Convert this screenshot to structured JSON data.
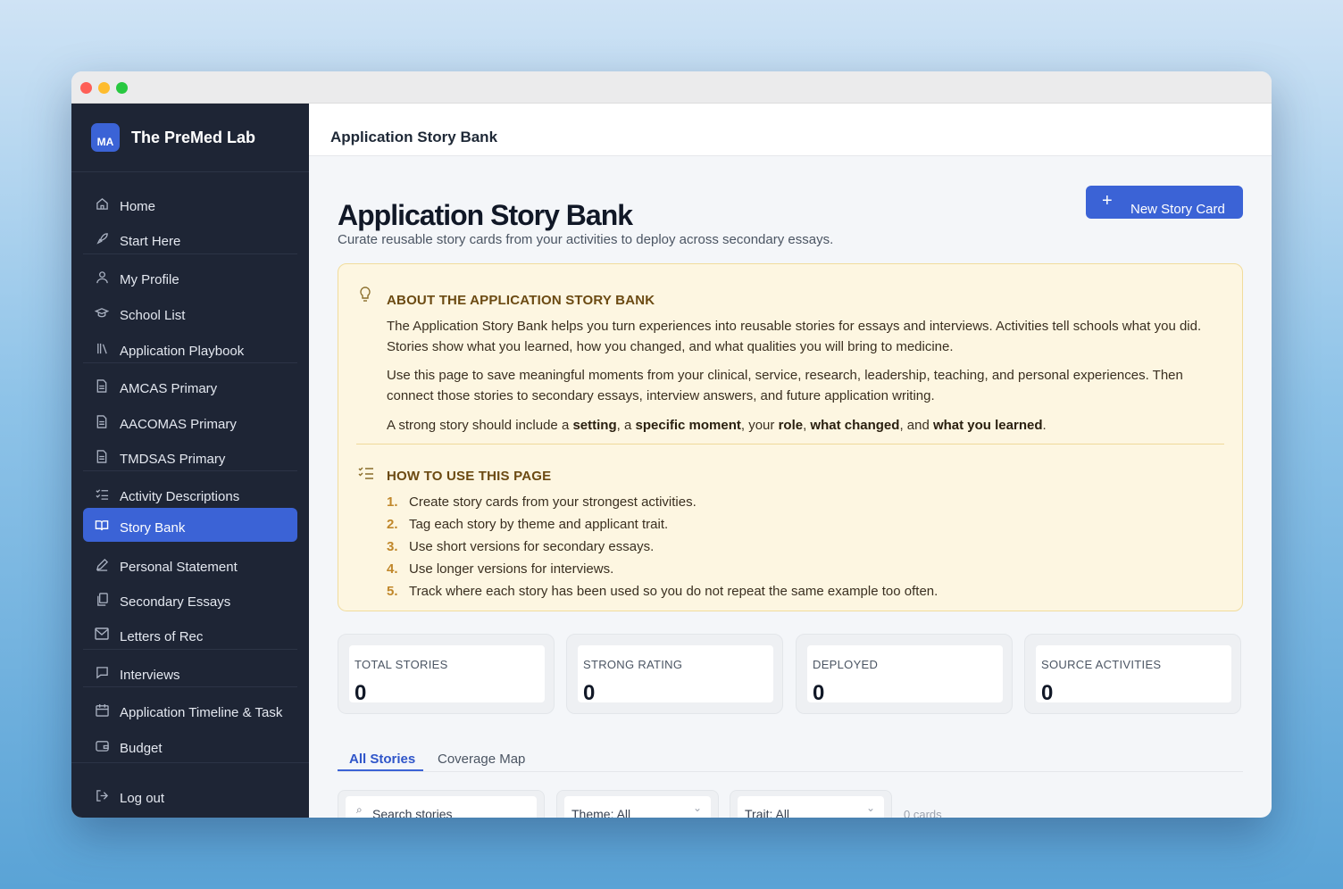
{
  "brand": {
    "logo_text": "MA",
    "name": "The PreMed Lab"
  },
  "sidebar": {
    "items": [
      {
        "label": "Home",
        "icon": "home-icon"
      },
      {
        "label": "Start Here",
        "icon": "rocket-icon"
      },
      {
        "label": "My Profile",
        "icon": "user-icon"
      },
      {
        "label": "School List",
        "icon": "graduation-cap-icon"
      },
      {
        "label": "Application Playbook",
        "icon": "library-icon"
      },
      {
        "label": "AMCAS Primary",
        "icon": "document-icon"
      },
      {
        "label": "AACOMAS Primary",
        "icon": "document-icon"
      },
      {
        "label": "TMDSAS Primary",
        "icon": "document-icon"
      },
      {
        "label": "Activity Descriptions",
        "icon": "list-check-icon"
      },
      {
        "label": "Story Bank",
        "icon": "book-open-icon",
        "active": true
      },
      {
        "label": "Personal Statement",
        "icon": "pencil-icon"
      },
      {
        "label": "Secondary Essays",
        "icon": "copy-icon"
      },
      {
        "label": "Letters of Rec",
        "icon": "mail-icon"
      },
      {
        "label": "Interviews",
        "icon": "message-icon"
      },
      {
        "label": "Application Timeline & Task",
        "icon": "calendar-icon"
      },
      {
        "label": "Budget",
        "icon": "wallet-icon"
      }
    ],
    "logout_label": "Log out"
  },
  "topbar": {
    "title": "Application Story Bank"
  },
  "page": {
    "title": "Application Story Bank",
    "subtitle": "Curate reusable story cards from your activities to deploy across secondary essays.",
    "new_button_label": "New Story Card"
  },
  "about": {
    "heading": "ABOUT THE APPLICATION STORY BANK",
    "p1": "The Application Story Bank helps you turn experiences into reusable stories for essays and interviews. Activities tell schools what you did. Stories show what you learned, how you changed, and what qualities you will bring to medicine.",
    "p2": "Use this page to save meaningful moments from your clinical, service, research, leadership, teaching, and personal experiences. Then connect those stories to secondary essays, interview answers, and future application writing.",
    "p3_parts": {
      "a": "A strong story should include a ",
      "b": "setting",
      "c": ", a ",
      "d": "specific moment",
      "e": ", your ",
      "f": "role",
      "g": ", ",
      "h": "what changed",
      "i": ", and ",
      "j": "what you learned",
      "k": "."
    },
    "howto_heading": "HOW TO USE THIS PAGE",
    "steps": [
      {
        "num": "1.",
        "text": "Create story cards from your strongest activities."
      },
      {
        "num": "2.",
        "text": "Tag each story by theme and applicant trait."
      },
      {
        "num": "3.",
        "text": "Use short versions for secondary essays."
      },
      {
        "num": "4.",
        "text": "Use longer versions for interviews."
      },
      {
        "num": "5.",
        "text": "Track where each story has been used so you do not repeat the same example too often."
      }
    ]
  },
  "stats": [
    {
      "label": "TOTAL STORIES",
      "value": "0"
    },
    {
      "label": "STRONG RATING",
      "value": "0"
    },
    {
      "label": "DEPLOYED",
      "value": "0"
    },
    {
      "label": "SOURCE ACTIVITIES",
      "value": "0"
    }
  ],
  "tabs": {
    "all": "All Stories",
    "coverage": "Coverage Map"
  },
  "filters": {
    "search_placeholder": "Search stories",
    "theme": "Theme: All",
    "trait": "Trait: All",
    "count": "0 cards"
  },
  "colors": {
    "accent": "#3b63d6",
    "sidebar_bg": "#1e2535",
    "about_bg": "#fdf6e1"
  }
}
